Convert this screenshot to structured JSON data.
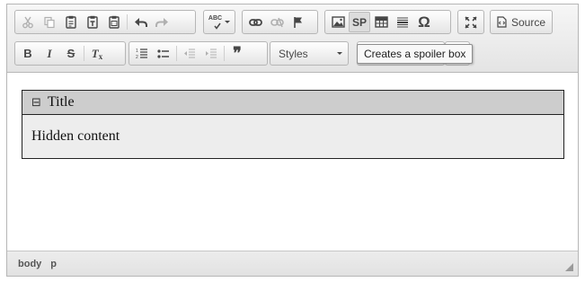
{
  "toolbar": {
    "row1": {
      "clipboard": [
        "cut-icon",
        "copy-icon",
        "paste-icon",
        "paste-text-icon",
        "paste-from-word-icon"
      ],
      "history": [
        "undo-icon",
        "redo-icon"
      ],
      "spellcheck": "ABC",
      "links": [
        "link-icon",
        "unlink-icon",
        "anchor-icon"
      ],
      "insert": {
        "image": "image-icon",
        "spoiler_label": "SP",
        "table": "table-icon",
        "hr": "horizontal-rule-icon",
        "special_char": "Ω"
      },
      "maximize": "maximize-icon",
      "source_label": "Source"
    },
    "row2": {
      "bold_label": "B",
      "italic_label": "I",
      "strike_label": "S",
      "remove_format_label": "T",
      "lists": [
        "numbered-list-icon",
        "bulleted-list-icon"
      ],
      "indent": [
        "decrease-indent-icon",
        "increase-indent-icon"
      ],
      "blockquote": "❞",
      "styles_label": "Styles"
    },
    "tooltip": "Creates a spoiler box"
  },
  "content": {
    "spoiler": {
      "toggle": "⊟",
      "title": "Title",
      "body": "Hidden content"
    }
  },
  "statusbar": {
    "path": [
      "body",
      "p"
    ]
  },
  "colors": {
    "toolbar_bg": "#e4e4e4",
    "spoiler_head": "#cdcdcd",
    "spoiler_body": "#ededed"
  }
}
